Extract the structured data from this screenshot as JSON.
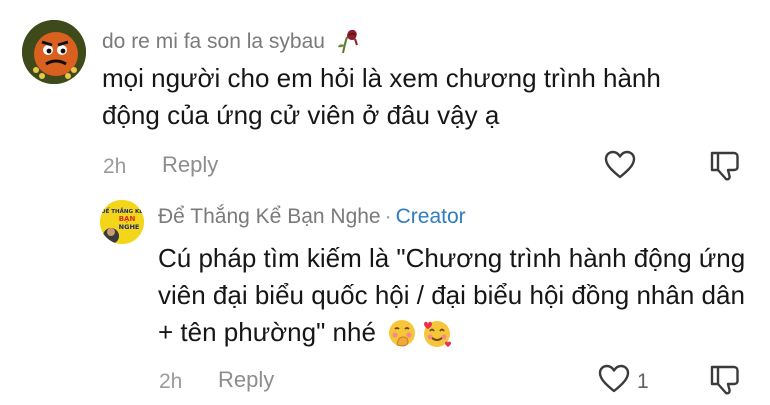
{
  "comment": {
    "username": "do re mi fa son la sybau",
    "username_emoji": "wilted-rose",
    "text": "mọi người cho em hỏi là xem chương trình hành động của ứng cử viên ở đâu vậy ạ",
    "time": "2h",
    "reply_label": "Reply",
    "like_icon": "heart-outline-icon",
    "dislike_icon": "thumbs-down-icon"
  },
  "reply": {
    "username": "Để Thắng Kể Bạn Nghe",
    "separator": "·",
    "creator_badge": "Creator",
    "avatar_text": [
      "ĐỂ THẮNG KỂ",
      "BẠN",
      "NGHE"
    ],
    "text": "Cú pháp tìm kiếm là \"Chương trình hành động ứng viên đại biểu quốc hội / đại biểu hội đồng nhân dân + tên phường\" nhé",
    "emojis": [
      "face-with-hand-over-mouth",
      "smiling-face-with-hearts"
    ],
    "time": "2h",
    "reply_label": "Reply",
    "like_count": "1",
    "like_icon": "heart-outline-icon",
    "dislike_icon": "thumbs-down-icon"
  },
  "colors": {
    "creator": "#2d7dbf",
    "meta": "#9b9b9b",
    "text": "#161616",
    "username": "#7a7a7a"
  }
}
